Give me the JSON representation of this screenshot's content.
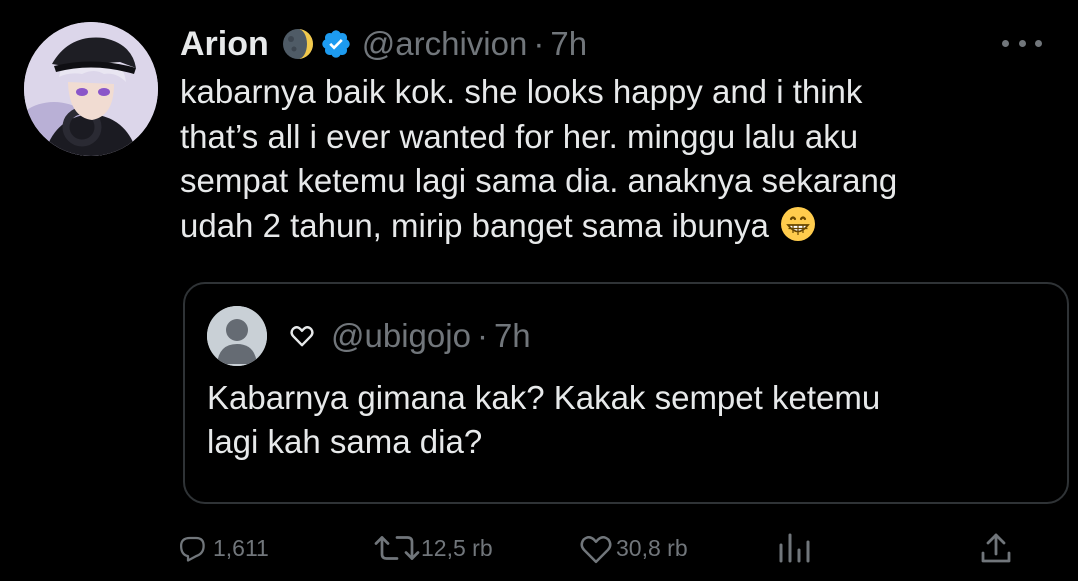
{
  "tweet": {
    "author_name": "Arion",
    "moon_emoji": "🌘",
    "handle": "@archivion",
    "separator": "·",
    "time": "7h",
    "text_lines": [
      "kabarnya baik kok. she looks happy and i think",
      "that’s all i ever wanted for her. minggu lalu aku",
      "sempat ketemu lagi sama dia. anaknya sekarang",
      "udah 2 tahun, mirip banget sama ibunya"
    ],
    "trailing_emoji": "😁",
    "icons": [
      "more-icon",
      "verified-badge-icon"
    ]
  },
  "quote": {
    "heart_symbol": "♡",
    "handle": "@ubigojo",
    "separator": "·",
    "time": "7h",
    "text_lines": [
      "Kabarnya gimana kak? Kakak sempet ketemu",
      "lagi kah sama dia?"
    ]
  },
  "actions": {
    "replies": "1,611",
    "retweets": "12,5 rb",
    "likes": "30,8 rb",
    "icons": [
      "reply-icon",
      "retweet-icon",
      "like-icon",
      "analytics-icon",
      "share-icon"
    ]
  },
  "colors": {
    "background": "#000000",
    "text": "#e7e9ea",
    "muted": "#71767b",
    "border": "#2f3336",
    "verified": "#1d9bf0"
  }
}
